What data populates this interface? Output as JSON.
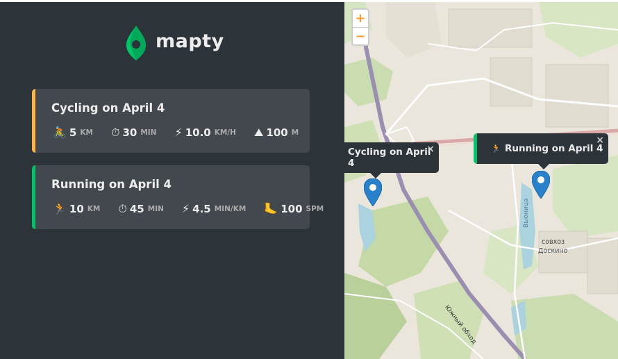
{
  "app": {
    "name": "mapty"
  },
  "workouts": [
    {
      "type": "cycling",
      "title": "Cycling on April 4",
      "details": [
        {
          "icon": "🚴",
          "value": "5",
          "unit": "km"
        },
        {
          "icon": "⏱",
          "value": "30",
          "unit": "min"
        },
        {
          "icon": "⚡",
          "value": "10.0",
          "unit": "km/h"
        },
        {
          "icon": "⛰",
          "value": "100",
          "unit": "m"
        }
      ]
    },
    {
      "type": "running",
      "title": "Running on April 4",
      "details": [
        {
          "icon": "🏃",
          "value": "10",
          "unit": "km"
        },
        {
          "icon": "⏱",
          "value": "45",
          "unit": "min"
        },
        {
          "icon": "⚡",
          "value": "4.5",
          "unit": "min/km"
        },
        {
          "icon": "🦶",
          "value": "100",
          "unit": "spm"
        }
      ]
    }
  ],
  "map": {
    "zoom_in": "+",
    "zoom_out": "−",
    "popups": [
      {
        "text": "Cycling on April 4",
        "close": "×"
      },
      {
        "icon": "🏃",
        "text": "Running on April 4",
        "close": "×"
      }
    ],
    "labels": {
      "road": "Южный обход",
      "river": "Вьюница",
      "village_line1": "совхоз",
      "village_line2": "Доскино"
    }
  },
  "colors": {
    "cycling": "#ffb545",
    "running": "#00c46a",
    "panel": "#2d3439",
    "card": "#42484d"
  }
}
